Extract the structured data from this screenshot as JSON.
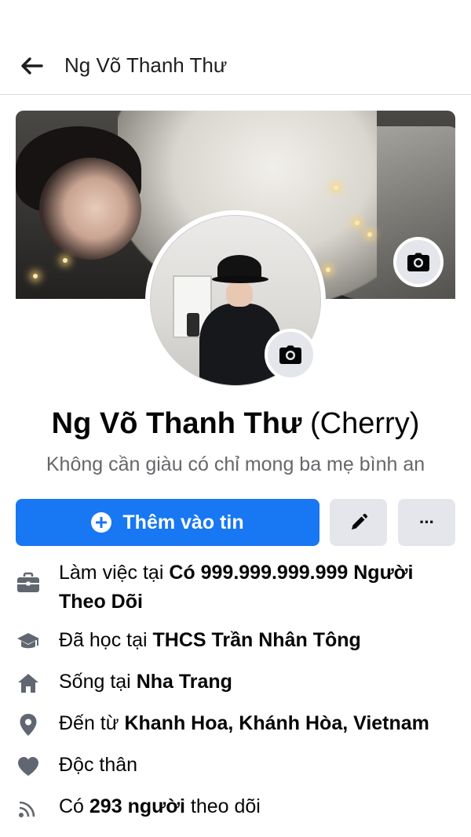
{
  "header": {
    "title": "Ng Võ Thanh Thư"
  },
  "profile": {
    "name": "Ng Võ Thanh Thư",
    "alt_name": "(Cherry)",
    "bio": "Không cần giàu có chỉ mong ba mẹ bình an"
  },
  "actions": {
    "add_story_label": "Thêm vào tin",
    "more_label": "···"
  },
  "details": {
    "work": {
      "prefix": "Làm việc tại ",
      "value": "Có 999.999.999.999 Người Theo Dõi"
    },
    "education": {
      "prefix": "Đã học tại ",
      "value": "THCS Trần Nhân Tông"
    },
    "lives": {
      "prefix": "Sống tại ",
      "value": "Nha Trang"
    },
    "from": {
      "prefix": "Đến từ ",
      "value": "Khanh Hoa, Khánh Hòa, Vietnam"
    },
    "relationship": {
      "value": "Độc thân"
    },
    "followers": {
      "prefix": "Có ",
      "value": "293 người",
      "suffix": " theo dõi"
    }
  },
  "colors": {
    "primary": "#1877f2",
    "secondary_bg": "#e4e6eb",
    "muted_text": "#65676b",
    "icon_gray": "#606770"
  },
  "icons": {
    "back": "arrow-left-icon",
    "cover_camera": "camera-icon",
    "avatar_camera": "camera-icon",
    "add": "plus-circle-icon",
    "edit": "pencil-icon",
    "more": "more-dots-icon",
    "work": "briefcase-icon",
    "education": "graduation-cap-icon",
    "lives": "home-icon",
    "from": "location-pin-icon",
    "relationship": "heart-icon",
    "followers": "rss-icon"
  }
}
